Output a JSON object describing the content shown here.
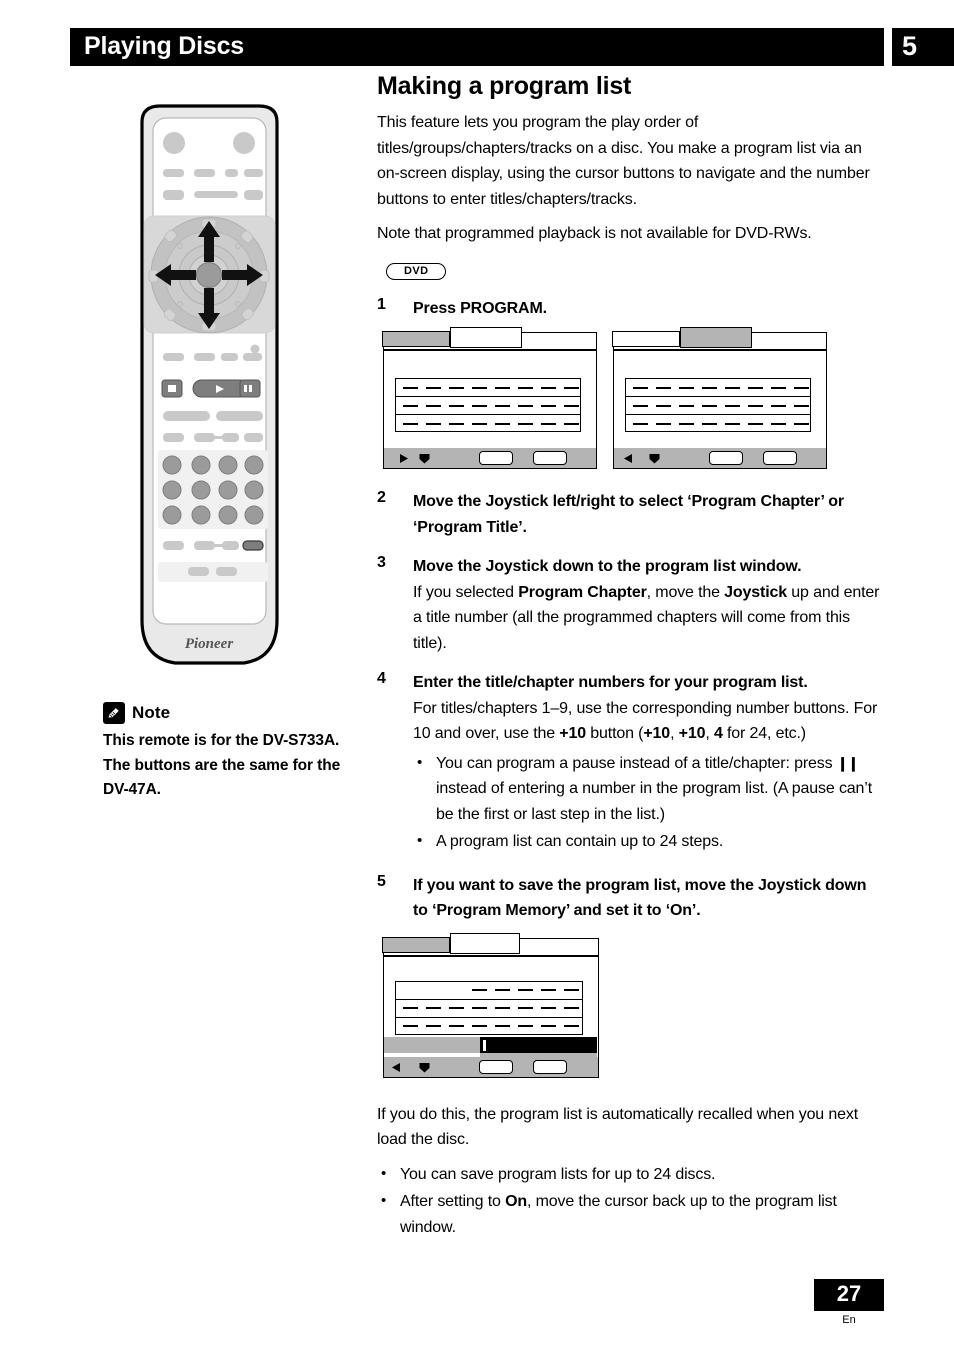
{
  "header": {
    "section_title": "Playing Discs",
    "chapter_number": "5"
  },
  "main": {
    "title": "Making a program list",
    "intro_paragraph": "This feature lets you program the play order of titles/groups/chapters/tracks on a disc. You make a program list via an on-screen display, using the cursor buttons to navigate and the number buttons to enter titles/chapters/tracks.",
    "note_paragraph": "Note that programmed playback is not available for DVD-RWs.",
    "disc_badge": "DVD",
    "steps": [
      {
        "number": "1",
        "head": "Press PROGRAM."
      },
      {
        "number": "2",
        "head": "Move the Joystick left/right to select ‘Program Chapter’ or ‘Program Title’."
      },
      {
        "number": "3",
        "head": "Move the Joystick down to the program list window.",
        "body_prefix": "If you selected ",
        "body_bold1": "Program Chapter",
        "body_mid": ", move the ",
        "body_bold2": "Joystick",
        "body_suffix": " up and enter a title number (all the programmed chapters will come from this title)."
      },
      {
        "number": "4",
        "head": "Enter the title/chapter numbers for your program list.",
        "body_prefix": "For titles/chapters 1–9, use the corresponding number buttons. For 10 and over, use the ",
        "body_bold1": "+10",
        "body_mid": " button (",
        "body_bold2": "+10",
        "body_mid2": ", ",
        "body_bold3": "+10",
        "body_mid3": ", ",
        "body_bold4": "4",
        "body_suffix": " for 24, etc.)",
        "bullets": [
          {
            "pre": "You can program a pause instead of a title/chapter: press ",
            "glyph": "❙❙",
            "post": " instead of entering a number in the program list. (A pause can’t be the first or last step in the list.)"
          },
          {
            "pre": "A program list can contain up to 24 steps.",
            "glyph": "",
            "post": ""
          }
        ]
      },
      {
        "number": "5",
        "head": "If you want to save the program list, move the Joystick down to ‘Program Memory’ and set it to ‘On’."
      }
    ],
    "closing_paragraph": "If you do this, the program list is automatically recalled when you next load the disc.",
    "closing_bullets": [
      {
        "pre": "You can save program lists for up to 24 discs.",
        "bold": "",
        "post": ""
      },
      {
        "pre": "After setting to ",
        "bold": "On",
        "post": ", move the cursor back up to the program list window."
      }
    ]
  },
  "osd_screens": [
    {
      "id": "osd-program-chapter",
      "selected_tab": "left",
      "left_glyph": "▶",
      "down_glyph": "♥",
      "rows": 3,
      "dashes_per_row": [
        8,
        8,
        8
      ],
      "has_memory_bars": false
    },
    {
      "id": "osd-program-title",
      "selected_tab": "right",
      "left_glyph": "◀",
      "down_glyph": "♥",
      "rows": 3,
      "dashes_per_row": [
        8,
        8,
        8
      ],
      "has_memory_bars": false
    },
    {
      "id": "osd-program-memory",
      "selected_tab": "left",
      "left_glyph": "◀",
      "down_glyph": "♥",
      "rows": 3,
      "dashes_per_row": [
        5,
        8,
        8
      ],
      "has_memory_bars": true
    }
  ],
  "sidebar": {
    "note_label": "Note",
    "note_text": "This remote is for the DV-S733A. The buttons are the same for the DV-47A.",
    "remote_brand": "Pioneer"
  },
  "footer": {
    "page_number": "27",
    "language": "En"
  },
  "colors": {
    "header_bg": "#000000",
    "osd_gray": "#b4b4b4",
    "remote_body": "#e8e8e8",
    "remote_button": "#c9c9c9",
    "remote_dark_button": "#7a7a7a"
  }
}
